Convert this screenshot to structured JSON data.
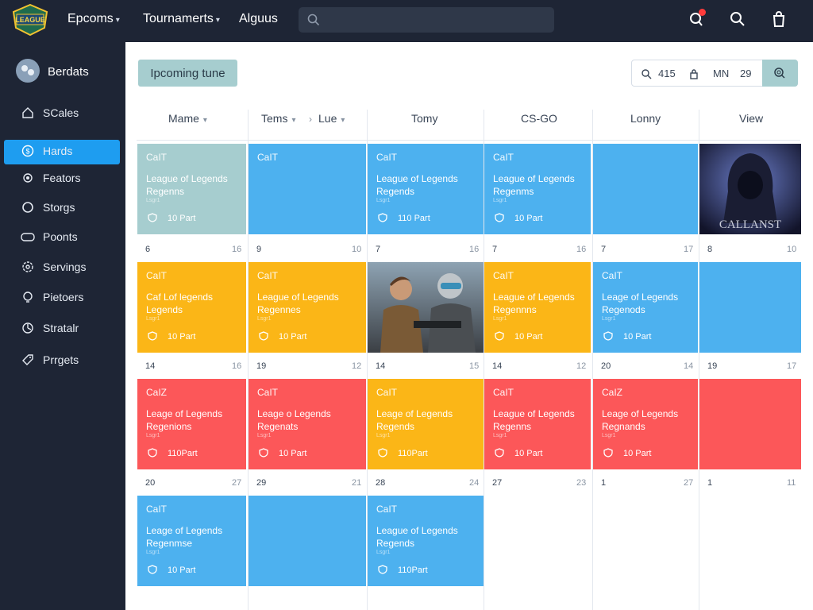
{
  "app": {
    "logo_text": "LEAGUE"
  },
  "topnav": {
    "items": [
      {
        "label": "Epcoms",
        "chevron": true
      },
      {
        "label": "Tournamerts",
        "chevron": true
      },
      {
        "label": "Alguus",
        "chevron": false
      }
    ],
    "search_placeholder": ""
  },
  "sidebar": {
    "profile_name": "Berdats",
    "items": [
      {
        "label": "SCales",
        "icon": "home-icon"
      },
      {
        "label": "Hards",
        "icon": "dollar-icon",
        "active": true
      },
      {
        "label": "Feators",
        "icon": "gear-icon"
      },
      {
        "label": "Storgs",
        "icon": "circle-icon"
      },
      {
        "label": "Poonts",
        "icon": "controller-icon"
      },
      {
        "label": "Servings",
        "icon": "settings-icon"
      },
      {
        "label": "Pietoers",
        "icon": "bulb-icon"
      },
      {
        "label": "Stratalr",
        "icon": "chart-icon"
      },
      {
        "label": "Prrgets",
        "icon": "tag-icon"
      }
    ]
  },
  "main": {
    "upcoming_label": "Ipcoming tune",
    "filter": {
      "f1": "415",
      "f2": "MN",
      "f3": "29"
    },
    "columns": [
      {
        "label": "Mame",
        "chevron": true
      },
      {
        "label": "Tems",
        "chevron": true
      },
      {
        "label": "Lue",
        "chevron": true
      },
      {
        "label": "Tomy",
        "chevron": false
      },
      {
        "label": "CS-GO",
        "chevron": false
      },
      {
        "label": "Lonny",
        "chevron": false
      },
      {
        "label": "View",
        "chevron": false
      }
    ],
    "day_rows": [
      [
        [
          "6",
          "16"
        ],
        [
          "9",
          "10"
        ],
        [
          "7",
          "16"
        ],
        [
          "7",
          "16"
        ],
        [
          "7",
          "17"
        ],
        [
          "8",
          "10"
        ]
      ],
      [
        [
          "14",
          "16"
        ],
        [
          "19",
          "12"
        ],
        [
          "14",
          "15"
        ],
        [
          "14",
          "12"
        ],
        [
          "20",
          "14"
        ],
        [
          "19",
          "17"
        ]
      ],
      [
        [
          "20",
          "27"
        ],
        [
          "29",
          "21"
        ],
        [
          "28",
          "24"
        ],
        [
          "27",
          "23"
        ],
        [
          "1",
          "27"
        ],
        [
          "1",
          "11"
        ]
      ]
    ],
    "cards": [
      {
        "title": "CaIT",
        "game1": "League of Legends",
        "game2": "Regenns",
        "small": "Lsgr1",
        "part": "10 Part"
      },
      {
        "title": "CaIT",
        "game1": "",
        "game2": "",
        "small": "",
        "part": ""
      },
      {
        "title": "CaIT",
        "game1": "League of Legends",
        "game2": "Regends",
        "small": "Lsgr1",
        "part": "110 Part"
      },
      {
        "title": "CaIT",
        "game1": "League of Legends",
        "game2": "Regenms",
        "small": "Lsgr1",
        "part": "10 Part"
      },
      {
        "title": "",
        "game1": "",
        "game2": "",
        "small": "",
        "part": ""
      },
      {
        "title": "CaIT",
        "game1": "Caf Lof legends",
        "game2": "Legends",
        "small": "Lsgr1",
        "part": "10 Part"
      },
      {
        "title": "CaIT",
        "game1": "League of Legends",
        "game2": "Regennes",
        "small": "Lsgr1",
        "part": "10 Part"
      },
      {
        "title": "CaIT",
        "game1": "League of Legends",
        "game2": "Regennns",
        "small": "Lsgr1",
        "part": "10 Part"
      },
      {
        "title": "CaIT",
        "game1": "Leage of Legends",
        "game2": "Regenods",
        "small": "Lsgr1",
        "part": "10 Part"
      },
      {
        "title": "",
        "game1": "",
        "game2": "",
        "small": "",
        "part": ""
      },
      {
        "title": "CaIZ",
        "game1": "Leage of Legends",
        "game2": "Regenions",
        "small": "Lsgr1",
        "part": "110Part"
      },
      {
        "title": "CaIT",
        "game1": "Leage o Legends",
        "game2": "Regenats",
        "small": "Lsgr1",
        "part": "10 Part"
      },
      {
        "title": "CaIT",
        "game1": "Leage of Legends",
        "game2": "Regends",
        "small": "Lsgr1",
        "part": "110Part"
      },
      {
        "title": "CaIT",
        "game1": "League of Legends",
        "game2": "Regenns",
        "small": "Lsgr1",
        "part": "10 Part"
      },
      {
        "title": "CaIZ",
        "game1": "Leage of Legends",
        "game2": "Regnands",
        "small": "Lsgr1",
        "part": "10 Part"
      },
      {
        "title": "",
        "game1": "",
        "game2": "",
        "small": "",
        "part": ""
      },
      {
        "title": "CaIT",
        "game1": "Leage of Legends",
        "game2": "Regenmse",
        "small": "Lsgr1",
        "part": "10 Part"
      },
      {
        "title": "",
        "game1": "",
        "game2": "",
        "small": "",
        "part": ""
      },
      {
        "title": "CaIT",
        "game1": "League of Legends",
        "game2": "Regends",
        "small": "Lsgr1",
        "part": "110Part"
      }
    ],
    "image_caption": "CALLANST"
  },
  "colors": {
    "sidebar": "#1e2535",
    "active": "#1e9df0",
    "teal": "#a6cdcf",
    "blue": "#4db1ef",
    "yellow": "#fbb617",
    "red": "#fc5759"
  }
}
